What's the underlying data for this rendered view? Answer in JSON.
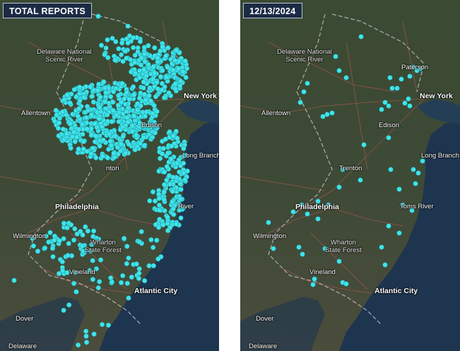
{
  "left_panel": {
    "title": "TOTAL REPORTS",
    "labels": {
      "delaware_park": "Delaware National\nScenic River",
      "new_york": "New York",
      "allentown": "Allentown",
      "edison": "Edison",
      "long_branch": "Long Branch",
      "trenton": "nton",
      "philadelphia": "Philadelphia",
      "toms_river": "River",
      "wilmington": "Wilmington",
      "wharton": "Wharton\nState Forest",
      "vineland": "Vineland",
      "atlantic_city": "Atlantic City",
      "dover": "Dover",
      "delaware_state": "Delaware"
    },
    "marker_color": "#3fe3ea"
  },
  "right_panel": {
    "title": "12/13/2024",
    "labels": {
      "delaware_park": "Delaware National\nScenic River",
      "paterson": "Paterson",
      "new_york": "New York",
      "allentown": "Allentown",
      "edison": "Edison",
      "long_branch": "Long Branch",
      "trenton": "Trenton",
      "philadelphia": "Philadelphia",
      "toms_river": "Toms River",
      "wilmington": "Wilmington",
      "wharton": "Wharton\nState Forest",
      "vineland": "Vineland",
      "atlantic_city": "Atlantic City",
      "dover": "Dover",
      "delaware_state": "Delaware"
    },
    "marker_color": "#3fe3ea"
  },
  "colors": {
    "land": "#3c4a34",
    "water": "#1e3550",
    "road": "#a8564a",
    "border": "#c9c9c9",
    "badge_bg": "#1c2a44"
  }
}
